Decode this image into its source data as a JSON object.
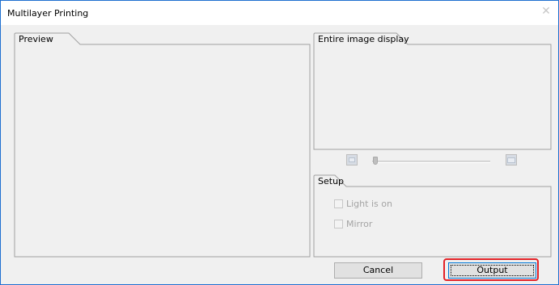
{
  "window": {
    "title": "Multilayer Printing",
    "close_glyph": "✕"
  },
  "preview": {
    "label": "Preview"
  },
  "entire_image": {
    "label": "Entire image display",
    "zoom": {
      "value": 0
    }
  },
  "setup": {
    "label": "Setup",
    "options": [
      {
        "label": "Light is on",
        "checked": false,
        "enabled": false
      },
      {
        "label": "Mirror",
        "checked": false,
        "enabled": false
      }
    ]
  },
  "buttons": {
    "cancel": "Cancel",
    "output": "Output"
  },
  "colors": {
    "highlight": "#e32127",
    "focus": "#0078d7"
  }
}
